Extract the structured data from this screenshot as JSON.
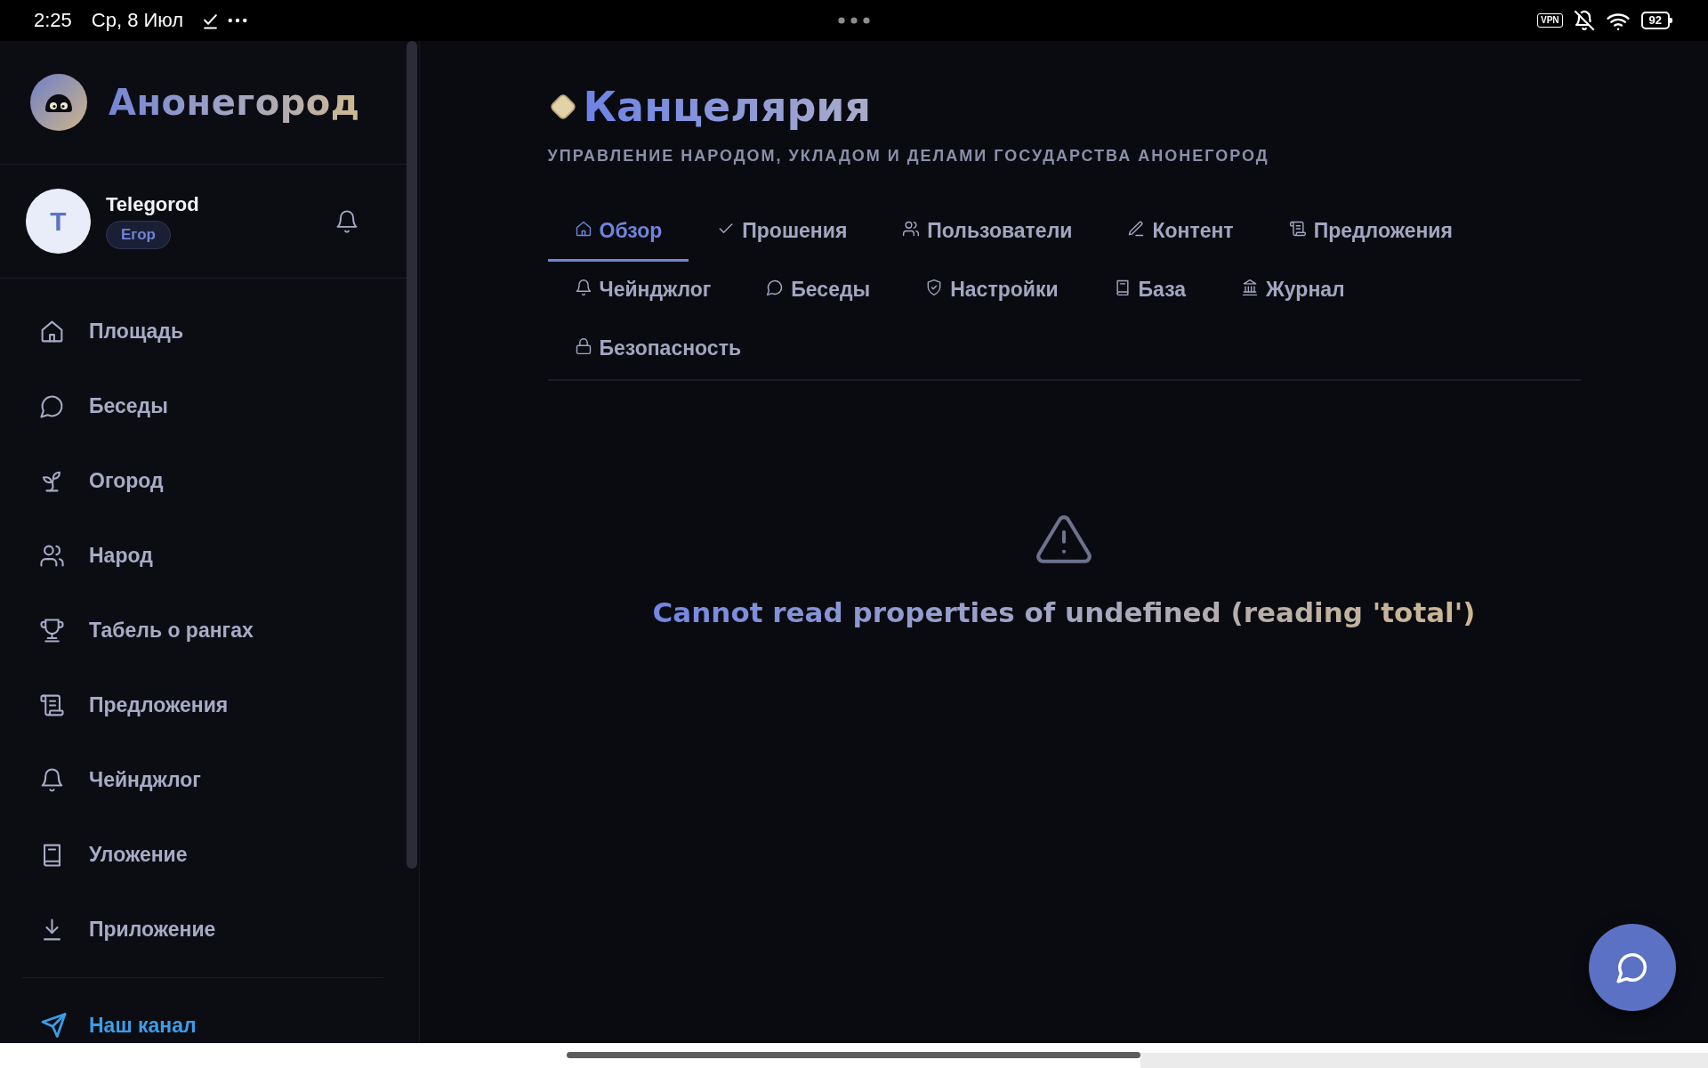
{
  "status_bar": {
    "time": "2:25",
    "date": "Ср, 8 Июл",
    "vpn": "VPN",
    "battery": "92"
  },
  "sidebar": {
    "brand": "Анонегород",
    "user": {
      "initial": "T",
      "name": "Telegorod",
      "role": "Егор"
    },
    "nav": [
      {
        "label": "Площадь",
        "selected": false
      },
      {
        "label": "Беседы",
        "selected": false
      },
      {
        "label": "Огород",
        "selected": false
      },
      {
        "label": "Народ",
        "selected": false
      },
      {
        "label": "Табель о рангах",
        "selected": false
      },
      {
        "label": "Предложения",
        "selected": false
      },
      {
        "label": "Чейнджлог",
        "selected": false
      },
      {
        "label": "Уложение",
        "selected": false
      },
      {
        "label": "Приложение",
        "selected": false
      }
    ],
    "channel": {
      "label": "Наш канал"
    }
  },
  "page": {
    "title": "Канцелярия",
    "subtitle": "УПРАВЛЕНИЕ НАРОДОМ, УКЛАДОМ И ДЕЛАМИ ГОСУДАРСТВА АНОНЕГОРОД",
    "tabs": [
      {
        "label": "Обзор",
        "selected": true
      },
      {
        "label": "Прошения",
        "selected": false
      },
      {
        "label": "Пользователи",
        "selected": false
      },
      {
        "label": "Контент",
        "selected": false
      },
      {
        "label": "Предложения",
        "selected": false
      },
      {
        "label": "Чейнджлог",
        "selected": false
      },
      {
        "label": "Беседы",
        "selected": false
      },
      {
        "label": "Настройки",
        "selected": false
      },
      {
        "label": "База",
        "selected": false
      },
      {
        "label": "Журнал",
        "selected": false
      },
      {
        "label": "Безопасность",
        "selected": false
      }
    ],
    "error": {
      "message": "Cannot read properties of undefined (reading 'total')"
    }
  }
}
